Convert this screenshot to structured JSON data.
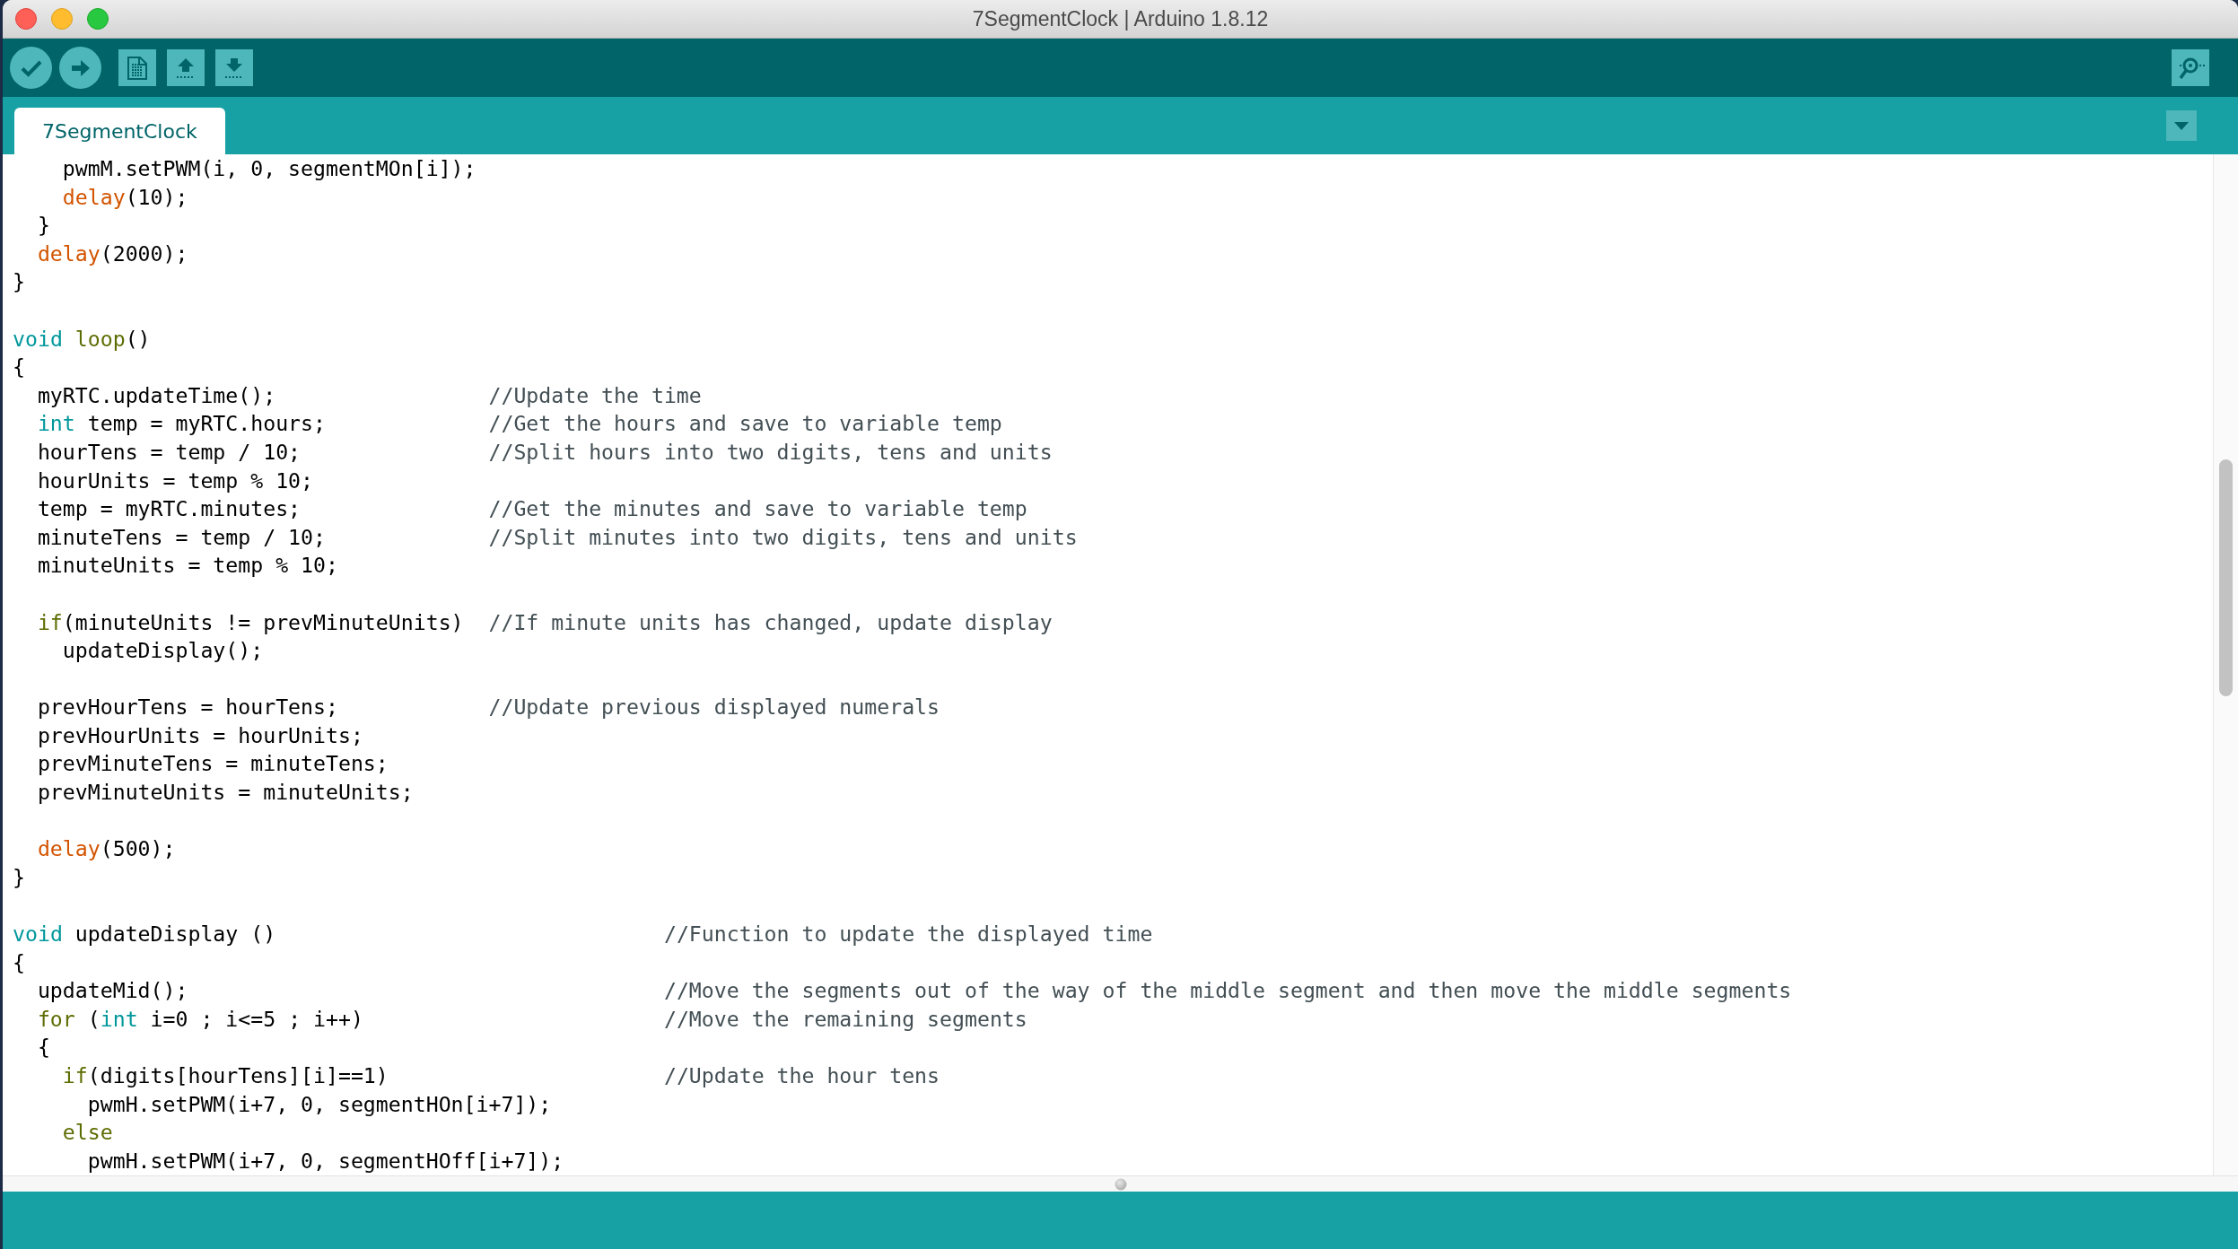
{
  "window": {
    "title": "7SegmentClock | Arduino 1.8.12"
  },
  "tabs": [
    {
      "label": "7SegmentClock",
      "selected": true
    }
  ],
  "editor": {
    "sections": [
      {
        "paragraphs": [
          {
            "lines": [
              {
                "code": [
                  {
                    "kind": "plain",
                    "text": "    pwmM.setPWM(i, 0, segmentMOn[i]);"
                  }
                ]
              },
              {
                "code": [
                  {
                    "kind": "builtin",
                    "text": "    delay"
                  },
                  {
                    "kind": "plain",
                    "text": "(10);"
                  }
                ]
              },
              {
                "code": [
                  {
                    "kind": "plain",
                    "text": "  }"
                  }
                ]
              },
              {
                "code": [
                  {
                    "kind": "builtin",
                    "text": "  delay"
                  },
                  {
                    "kind": "plain",
                    "text": "(2000);"
                  }
                ]
              },
              {
                "code": [
                  {
                    "kind": "plain",
                    "text": "}"
                  }
                ]
              }
            ]
          }
        ]
      },
      {
        "paragraphs": [
          {
            "lines": [
              {
                "code": [
                  {
                    "kind": "type",
                    "text": "void "
                  },
                  {
                    "kind": "keyword",
                    "text": "loop"
                  },
                  {
                    "kind": "plain",
                    "text": "()"
                  }
                ]
              },
              {
                "code": [
                  {
                    "kind": "plain",
                    "text": "{"
                  }
                ]
              },
              {
                "code": [
                  {
                    "kind": "plain",
                    "text": "  myRTC.updateTime();"
                  }
                ],
                "comment": "//Update the time"
              },
              {
                "code": [
                  {
                    "kind": "type",
                    "text": "  int"
                  },
                  {
                    "kind": "plain",
                    "text": " temp = myRTC.hours;"
                  }
                ],
                "comment": "//Get the hours and save to variable temp"
              },
              {
                "code": [
                  {
                    "kind": "plain",
                    "text": "  hourTens = temp / 10;"
                  }
                ],
                "comment": "//Split hours into two digits, tens and units"
              },
              {
                "code": [
                  {
                    "kind": "plain",
                    "text": "  hourUnits = temp % 10;"
                  }
                ]
              },
              {
                "code": [
                  {
                    "kind": "plain",
                    "text": "  temp = myRTC.minutes;"
                  }
                ],
                "comment": "//Get the minutes and save to variable temp"
              },
              {
                "code": [
                  {
                    "kind": "plain",
                    "text": "  minuteTens = temp / 10;"
                  }
                ],
                "comment": "//Split minutes into two digits, tens and units"
              },
              {
                "code": [
                  {
                    "kind": "plain",
                    "text": "  minuteUnits = temp % 10;"
                  }
                ]
              }
            ]
          },
          {
            "lines": [
              {
                "code": [
                  {
                    "kind": "keyword",
                    "text": "  if"
                  },
                  {
                    "kind": "plain",
                    "text": "(minuteUnits != prevMinuteUnits)"
                  }
                ],
                "comment": "//If minute units has changed, update display"
              },
              {
                "code": [
                  {
                    "kind": "plain",
                    "text": "    updateDisplay();"
                  }
                ]
              }
            ]
          },
          {
            "lines": [
              {
                "code": [
                  {
                    "kind": "plain",
                    "text": "  prevHourTens = hourTens;"
                  }
                ],
                "comment": "//Update previous displayed numerals"
              },
              {
                "code": [
                  {
                    "kind": "plain",
                    "text": "  prevHourUnits = hourUnits;"
                  }
                ]
              },
              {
                "code": [
                  {
                    "kind": "plain",
                    "text": "  prevMinuteTens = minuteTens;"
                  }
                ]
              },
              {
                "code": [
                  {
                    "kind": "plain",
                    "text": "  prevMinuteUnits = minuteUnits;"
                  }
                ]
              }
            ]
          },
          {
            "lines": [
              {
                "code": [
                  {
                    "kind": "builtin",
                    "text": "  delay"
                  },
                  {
                    "kind": "plain",
                    "text": "(500);"
                  }
                ]
              },
              {
                "code": [
                  {
                    "kind": "plain",
                    "text": "}"
                  }
                ]
              }
            ]
          }
        ]
      },
      {
        "paragraphs": [
          {
            "lines": [
              {
                "code": [
                  {
                    "kind": "type",
                    "text": "void "
                  },
                  {
                    "kind": "plain",
                    "text": "updateDisplay ()"
                  }
                ],
                "comment": "//Function to update the displayed time"
              },
              {
                "code": [
                  {
                    "kind": "plain",
                    "text": "{"
                  }
                ]
              },
              {
                "code": [
                  {
                    "kind": "plain",
                    "text": "  updateMid();"
                  }
                ],
                "comment": "//Move the segments out of the way of the middle segment and then move the middle segments"
              },
              {
                "code": [
                  {
                    "kind": "keyword",
                    "text": "  for"
                  },
                  {
                    "kind": "plain",
                    "text": " ("
                  },
                  {
                    "kind": "type",
                    "text": "int"
                  },
                  {
                    "kind": "plain",
                    "text": " i=0 ; i<=5 ; i++)"
                  }
                ],
                "comment": "//Move the remaining segments"
              },
              {
                "code": [
                  {
                    "kind": "plain",
                    "text": "  {"
                  }
                ]
              },
              {
                "code": [
                  {
                    "kind": "keyword",
                    "text": "    if"
                  },
                  {
                    "kind": "plain",
                    "text": "(digits[hourTens][i]==1)"
                  }
                ],
                "comment": "//Update the hour tens"
              },
              {
                "code": [
                  {
                    "kind": "plain",
                    "text": "      pwmH.setPWM(i+7, 0, segmentHOn[i+7]);"
                  }
                ]
              },
              {
                "code": [
                  {
                    "kind": "keyword",
                    "text": "    else"
                  }
                ]
              },
              {
                "code": [
                  {
                    "kind": "plain",
                    "text": "      pwmH.setPWM(i+7, 0, segmentHOff[i+7]);"
                  }
                ]
              }
            ]
          }
        ]
      }
    ]
  }
}
